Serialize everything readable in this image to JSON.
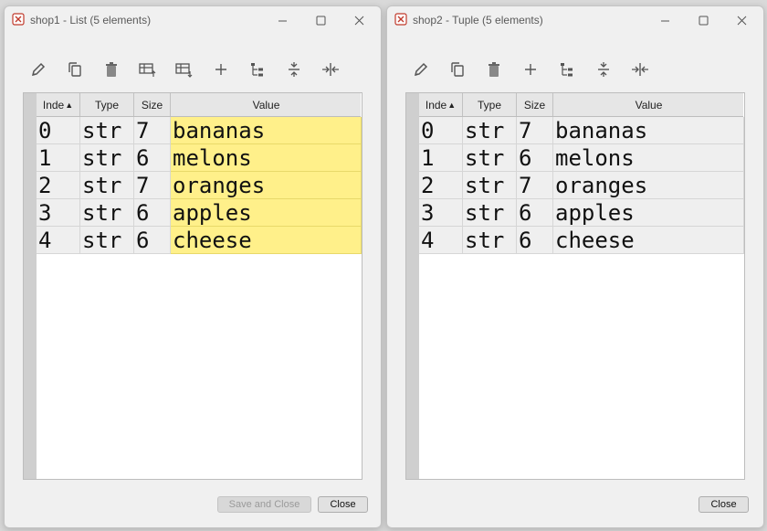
{
  "windows": [
    {
      "title": "shop1 - List (5 elements)",
      "headers": {
        "index": "Inde",
        "type": "Type",
        "size": "Size",
        "value": "Value"
      },
      "rows": [
        {
          "index": "0",
          "type": "str",
          "size": "7",
          "value": "bananas"
        },
        {
          "index": "1",
          "type": "str",
          "size": "6",
          "value": "melons"
        },
        {
          "index": "2",
          "type": "str",
          "size": "7",
          "value": "oranges"
        },
        {
          "index": "3",
          "type": "str",
          "size": "6",
          "value": "apples"
        },
        {
          "index": "4",
          "type": "str",
          "size": "6",
          "value": "cheese"
        }
      ],
      "buttons": {
        "save_close": "Save and Close",
        "close": "Close"
      }
    },
    {
      "title": "shop2 - Tuple (5 elements)",
      "headers": {
        "index": "Inde",
        "type": "Type",
        "size": "Size",
        "value": "Value"
      },
      "rows": [
        {
          "index": "0",
          "type": "str",
          "size": "7",
          "value": "bananas"
        },
        {
          "index": "1",
          "type": "str",
          "size": "6",
          "value": "melons"
        },
        {
          "index": "2",
          "type": "str",
          "size": "7",
          "value": "oranges"
        },
        {
          "index": "3",
          "type": "str",
          "size": "6",
          "value": "apples"
        },
        {
          "index": "4",
          "type": "str",
          "size": "6",
          "value": "cheese"
        }
      ],
      "buttons": {
        "close": "Close"
      }
    }
  ],
  "icons": {
    "toolbar1": [
      "edit-icon",
      "copy-icon",
      "delete-icon",
      "insert-above-icon",
      "insert-below-icon",
      "add-icon",
      "tree-icon",
      "collapse-icon",
      "resize-columns-icon"
    ],
    "toolbar2": [
      "edit-icon",
      "copy-icon",
      "delete-icon",
      "add-icon",
      "tree-icon",
      "collapse-icon",
      "resize-columns-icon"
    ]
  },
  "colors": {
    "editable_cell": "#fff08a",
    "readonly_cell": "#efefef"
  }
}
